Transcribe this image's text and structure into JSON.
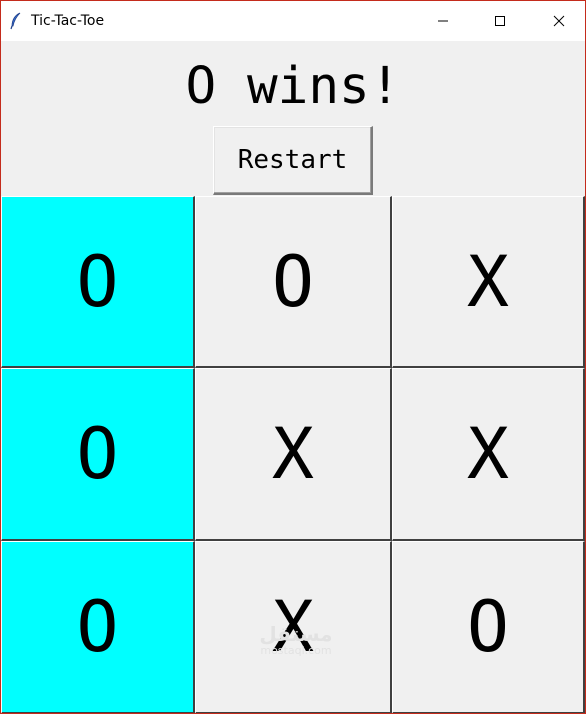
{
  "window": {
    "title": "Tic-Tac-Toe",
    "icons": {
      "app": "feather-icon",
      "minimize": "minimize-icon",
      "maximize": "maximize-icon",
      "close": "close-icon"
    },
    "colors": {
      "border": "#c42b1c",
      "client": "#f0f0f0",
      "win_highlight": "#00ffff"
    }
  },
  "game": {
    "status": "O wins!",
    "restart_label": "Restart",
    "board": [
      [
        "O",
        "O",
        "X"
      ],
      [
        "O",
        "X",
        "X"
      ],
      [
        "O",
        "X",
        "O"
      ]
    ],
    "winning_cells": [
      [
        0,
        0
      ],
      [
        1,
        0
      ],
      [
        2,
        0
      ]
    ]
  },
  "watermark": {
    "text": "مستقل",
    "domain": "mostaql.com"
  }
}
